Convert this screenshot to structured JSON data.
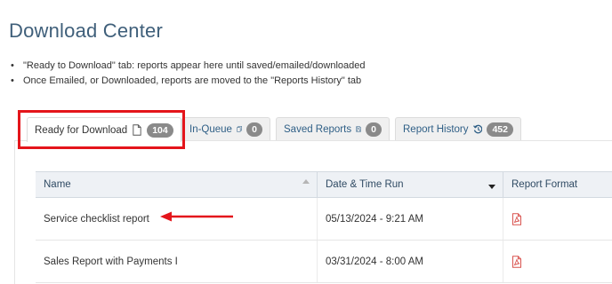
{
  "page": {
    "title": "Download Center",
    "notes": [
      "\"Ready to Download\" tab: reports appear here until saved/emailed/downloaded",
      "Once Emailed, or Downloaded, reports are moved to the \"Reports History\" tab"
    ]
  },
  "tabs": [
    {
      "label": "Ready for Download",
      "icon": "document-icon",
      "count": "104",
      "active": true
    },
    {
      "label": "In-Queue",
      "icon": "copy-icon",
      "count": "0",
      "active": false
    },
    {
      "label": "Saved Reports",
      "icon": "save-icon",
      "count": "0",
      "active": false
    },
    {
      "label": "Report History",
      "icon": "history-icon",
      "count": "452",
      "active": false
    }
  ],
  "table": {
    "columns": [
      "Name",
      "Date & Time Run",
      "Report Format"
    ],
    "sort": {
      "column": "Date & Time Run",
      "direction": "descending"
    },
    "rows": [
      {
        "name": "Service checklist report",
        "date": "05/13/2024 - 9:21 AM",
        "format_icon": "pdf-icon"
      },
      {
        "name": "Sales Report with Payments I",
        "date": "03/31/2024 - 8:00 AM",
        "format_icon": "pdf-icon"
      }
    ]
  },
  "colors": {
    "title": "#3f5f7a",
    "tab_link": "#2f5f86",
    "badge": "#8a8a8a",
    "highlight": "#e4151b",
    "header_bg": "#eef1f5",
    "pdf": "#d9534f"
  }
}
